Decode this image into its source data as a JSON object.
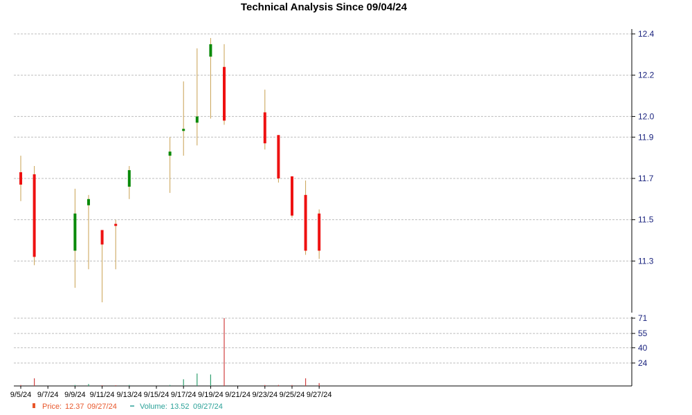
{
  "chart_data": {
    "type": "candlestick",
    "title": "Technical Analysis Since 09/04/24",
    "price_ylim": [
      11.05,
      12.4
    ],
    "price_ticks": [
      "11.3",
      "11.5",
      "11.7",
      "11.9",
      "12.0",
      "12.2",
      "12.4"
    ],
    "volume_ylim": [
      0,
      71
    ],
    "volume_ticks": [
      "24",
      "40",
      "55",
      "71"
    ],
    "x_ticks": [
      "9/5/24",
      "9/7/24",
      "9/9/24",
      "9/11/24",
      "9/13/24",
      "9/15/24",
      "9/17/24",
      "9/19/24",
      "9/21/24",
      "9/23/24",
      "9/25/24",
      "9/27/24"
    ],
    "grid": true,
    "colors": {
      "up": "#0a8a0a",
      "down": "#ee1111",
      "wick": "#c8a050",
      "volume_up": "#2e9e6e",
      "volume_down": "#d04040",
      "price_legend": "#e8562a",
      "volume_legend": "#2aa198"
    },
    "candles": [
      {
        "date": "9/5/24",
        "open": 11.73,
        "high": 11.81,
        "low": 11.59,
        "close": 11.67,
        "volume": 1
      },
      {
        "date": "9/6/24",
        "open": 11.72,
        "high": 11.76,
        "low": 11.28,
        "close": 11.32,
        "volume": 8
      },
      {
        "date": "9/9/24",
        "open": 11.35,
        "high": 11.65,
        "low": 11.17,
        "close": 11.53,
        "volume": 1
      },
      {
        "date": "9/10/24",
        "open": 11.57,
        "high": 11.62,
        "low": 11.26,
        "close": 11.6,
        "volume": 2
      },
      {
        "date": "9/11/24",
        "open": 11.45,
        "high": 11.45,
        "low": 11.1,
        "close": 11.38,
        "volume": 0
      },
      {
        "date": "9/12/24",
        "open": 11.48,
        "high": 11.5,
        "low": 11.26,
        "close": 11.47,
        "volume": 0
      },
      {
        "date": "9/13/24",
        "open": 11.66,
        "high": 11.76,
        "low": 11.6,
        "close": 11.74,
        "volume": 1
      },
      {
        "date": "9/16/24",
        "open": 11.81,
        "high": 11.9,
        "low": 11.63,
        "close": 11.83,
        "volume": 1
      },
      {
        "date": "9/17/24",
        "open": 11.93,
        "high": 12.17,
        "low": 11.81,
        "close": 11.94,
        "volume": 7
      },
      {
        "date": "9/18/24",
        "open": 11.97,
        "high": 12.33,
        "low": 11.86,
        "close": 12.0,
        "volume": 13
      },
      {
        "date": "9/19/24",
        "open": 12.29,
        "high": 12.38,
        "low": 11.99,
        "close": 12.35,
        "volume": 12
      },
      {
        "date": "9/20/24",
        "open": 12.24,
        "high": 12.35,
        "low": 11.96,
        "close": 11.98,
        "volume": 71
      },
      {
        "date": "9/23/24",
        "open": 12.02,
        "high": 12.13,
        "low": 11.84,
        "close": 11.87,
        "volume": 1
      },
      {
        "date": "9/24/24",
        "open": 11.91,
        "high": 11.91,
        "low": 11.68,
        "close": 11.7,
        "volume": 1
      },
      {
        "date": "9/25/24",
        "open": 11.71,
        "high": 11.71,
        "low": 11.51,
        "close": 11.52,
        "volume": 1
      },
      {
        "date": "9/26/24",
        "open": 11.62,
        "high": 11.69,
        "low": 11.33,
        "close": 11.35,
        "volume": 8
      },
      {
        "date": "9/27/24",
        "open": 11.53,
        "high": 11.55,
        "low": 11.31,
        "close": 11.35,
        "volume": 3
      }
    ],
    "legend": {
      "price_label": "Price:",
      "price_value": "12.37",
      "price_date": "09/27/24",
      "volume_label": "Volume:",
      "volume_value": "13.52",
      "volume_date": "09/27/24"
    }
  }
}
